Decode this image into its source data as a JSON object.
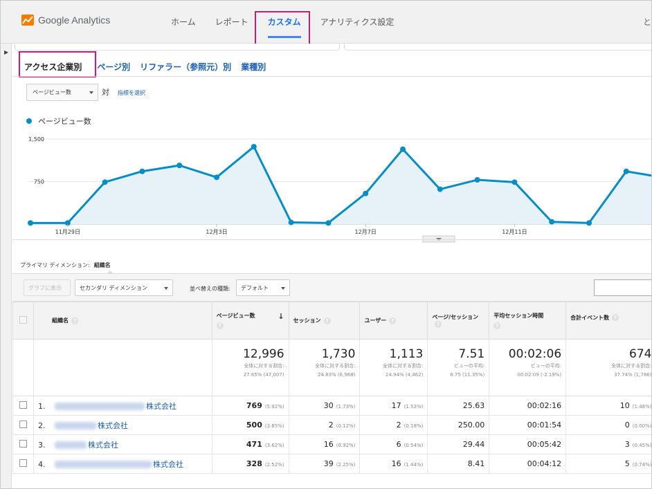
{
  "app": {
    "name": "Google Analytics"
  },
  "topnav": {
    "tabs": [
      "ホーム",
      "レポート",
      "カスタム",
      "アナリティクス設定"
    ],
    "active": "カスタム",
    "right_cut": "と"
  },
  "subtabs": [
    "アクセス企業別",
    "ページ別",
    "リファラー（参照元）別",
    "業種別"
  ],
  "metric": {
    "select": "ページビュー数",
    "vs": "対",
    "choose": "指標を選択"
  },
  "chart_data": {
    "type": "area",
    "series": [
      {
        "name": "ページビュー数",
        "values": [
          20,
          20,
          740,
          930,
          1035,
          825,
          1365,
          30,
          20,
          540,
          1320,
          615,
          780,
          740,
          40,
          20,
          930,
          820
        ]
      }
    ],
    "x_tick_labels": [
      "11月29日",
      "12月3日",
      "12月7日",
      "12月11日"
    ],
    "y_ticks": [
      "1,500",
      "750"
    ],
    "ylim": [
      0,
      1500
    ],
    "color": "#058dc7",
    "fill": "#e6f1f8"
  },
  "primary_dimension": {
    "label": "プライマリ ディメンション:",
    "value": "組織名"
  },
  "toolbar": {
    "graph": "グラフに表示",
    "secondary": "セカンダリ ディメンション",
    "sort_label": "並べ替えの種類:",
    "sort_value": "デフォルト"
  },
  "table": {
    "headers": [
      "組織名",
      "ページビュー数",
      "セッション",
      "ユーザー",
      "ページ/セッション",
      "平均セッション時間",
      "合計イベント数"
    ],
    "totals": [
      {
        "value": "12,996",
        "l1": "全体に対する割合:",
        "l2": "27.65% (47,007)"
      },
      {
        "value": "1,730",
        "l1": "全体に対する割合:",
        "l2": "24.83% (6,968)"
      },
      {
        "value": "1,113",
        "l1": "全体に対する割合:",
        "l2": "24.94% (4,462)"
      },
      {
        "value": "7.51",
        "l1": "ビューの平均:",
        "l2": "6.75 (11.35%)"
      },
      {
        "value": "00:02:06",
        "l1": "ビューの平均:",
        "l2": "00:02:09 (-2.19%)"
      },
      {
        "value": "674",
        "l1": "全体に対する割合:",
        "l2": "37.74% (1,786)"
      }
    ],
    "rows": [
      {
        "num": "1.",
        "name": "株式会社",
        "pv": "769",
        "pvp": "(5.92%)",
        "ss": "30",
        "ssp": "(1.73%)",
        "us": "17",
        "usp": "(1.53%)",
        "pps": "25.63",
        "dur": "00:02:16",
        "ev": "10",
        "evp": "(1.48%)"
      },
      {
        "num": "2.",
        "name": "株式会社",
        "pv": "500",
        "pvp": "(3.85%)",
        "ss": "2",
        "ssp": "(0.12%)",
        "us": "2",
        "usp": "(0.18%)",
        "pps": "250.00",
        "dur": "00:01:54",
        "ev": "0",
        "evp": "(0.00%)"
      },
      {
        "num": "3.",
        "name": "株式会社",
        "pv": "471",
        "pvp": "(3.62%)",
        "ss": "16",
        "ssp": "(0.92%)",
        "us": "6",
        "usp": "(0.54%)",
        "pps": "29.44",
        "dur": "00:05:42",
        "ev": "3",
        "evp": "(0.45%)"
      },
      {
        "num": "4.",
        "name": "株式会社",
        "pv": "328",
        "pvp": "(2.52%)",
        "ss": "39",
        "ssp": "(2.25%)",
        "us": "16",
        "usp": "(1.44%)",
        "pps": "8.41",
        "dur": "00:04:12",
        "ev": "5",
        "evp": "(0.74%)"
      }
    ]
  }
}
